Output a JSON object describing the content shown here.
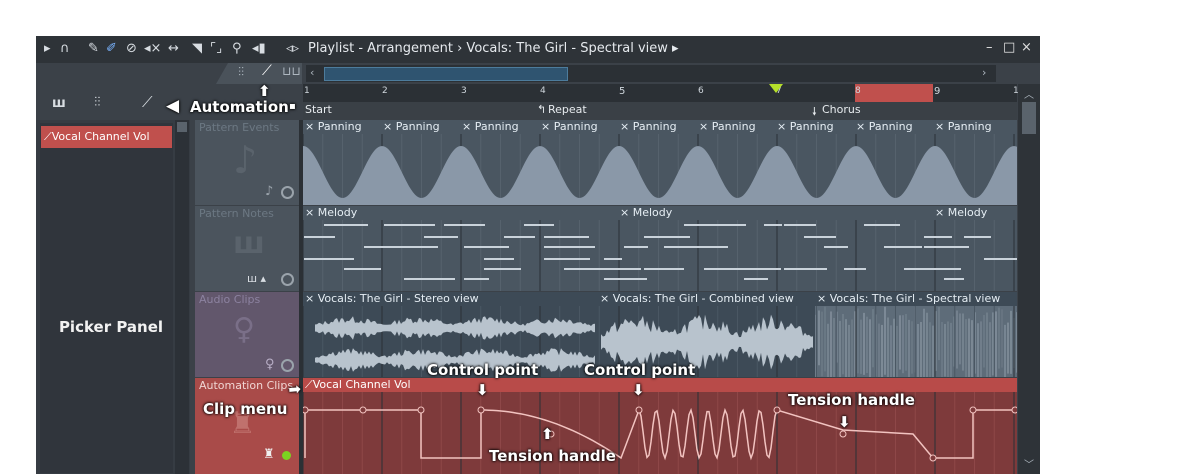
{
  "titlebar": {
    "title": "Playlist - Arrangement › Vocals: The Girl - Spectral view ▸",
    "icons": [
      "play-arrow-icon",
      "magnet-icon",
      "pencil-icon",
      "brush-icon",
      "delete-icon",
      "mute-icon",
      "slip-icon",
      "slice-icon",
      "select-icon",
      "zoom-icon",
      "playback-icon",
      "arrows-icon"
    ],
    "controls": {
      "minimize": "–",
      "maximize": "□",
      "close": "×"
    }
  },
  "picker": {
    "item": "Vocal Channel Vol",
    "panel_label": "Picker Panel"
  },
  "tracks": [
    {
      "name": "Pattern Events"
    },
    {
      "name": "Pattern Notes"
    },
    {
      "name": "Audio Clips"
    },
    {
      "name": "Automation Clips"
    }
  ],
  "ruler": {
    "bars": [
      "1",
      "2",
      "3",
      "4",
      "5",
      "6",
      "7",
      "8",
      "9",
      "1"
    ],
    "markers": {
      "start": "Start",
      "repeat": "Repeat",
      "chorus": "Chorus"
    }
  },
  "lanes": {
    "events_clip": "Panning",
    "notes_clip": "Melody",
    "audio_clips": [
      "Vocals: The Girl - Stereo view",
      "Vocals: The Girl - Combined view",
      "Vocals: The Girl - Spectral view"
    ],
    "automation_clip": "Vocal Channel Vol"
  },
  "annotations": {
    "automation": "Automation",
    "picker_panel": "Picker Panel",
    "clip_menu": "Clip menu",
    "control_point_1": "Control point",
    "control_point_2": "Control point",
    "tension_handle_1": "Tension handle",
    "tension_handle_2": "Tension handle"
  },
  "colors": {
    "automation_red": "#c0504d",
    "waveform": "#8a98a8",
    "lane_bg": "#4a5661",
    "ruler_marker_green": "#b6e02a"
  }
}
